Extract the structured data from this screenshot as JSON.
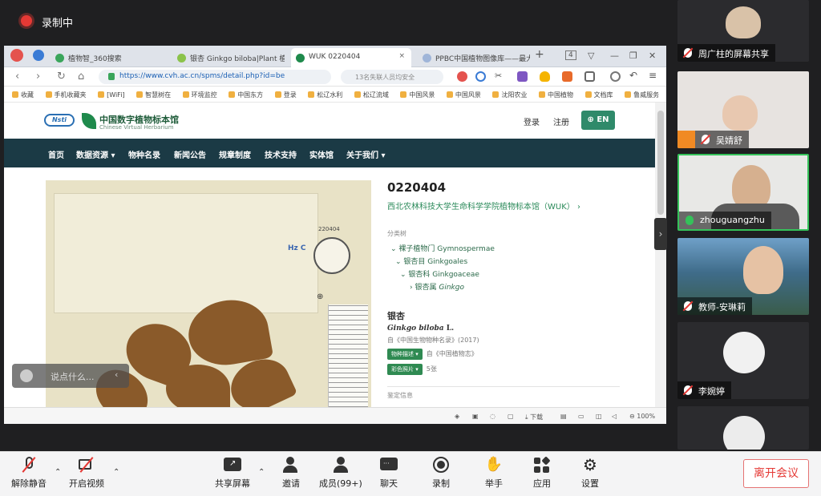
{
  "recording": {
    "label": "录制中"
  },
  "browser": {
    "tabs": [
      {
        "label": "植物智_360搜索"
      },
      {
        "label": "银杏 Ginkgo biloba|Plant 植物"
      },
      {
        "label": "WUK 0220404"
      },
      {
        "label": "PPBC中国植物图像库——最大"
      }
    ],
    "tab_count": "4",
    "url": "https://www.cvh.ac.cn/spms/detail.php?id=be",
    "search_placeholder": "13名失联人员均安全",
    "bookmarks": [
      "收藏",
      "手机收藏夹",
      "[WiFi]",
      "智慧树在",
      "环境监控",
      "中国东方",
      "登录",
      "松辽水利",
      "松辽流域",
      "中国风景",
      "中国风景",
      "沈阳农业",
      "中国植物",
      "文档库",
      "鲁威服务"
    ],
    "zoom": "100%",
    "status": {
      "download": "下载"
    }
  },
  "site": {
    "logo_text": "Nsti",
    "name_cn": "中国数字植物标本馆",
    "name_en": "Chinese Virtual Herbarium",
    "login": "登录",
    "register": "注册",
    "lang_button": "EN",
    "nav": [
      "首页",
      "数据资源",
      "物种名录",
      "新闻公告",
      "规章制度",
      "技术支持",
      "实体馆",
      "关于我们"
    ]
  },
  "specimen": {
    "label_number": "220404",
    "stamp_text": "Hz C",
    "code": "0220404",
    "institution": "西北农林科技大学生命科学学院植物标本馆（WUK）",
    "section_taxonomy": "分类树",
    "taxonomy": [
      {
        "cn": "裸子植物门",
        "latin": "Gymnospermae"
      },
      {
        "cn": "银杏目",
        "latin": "Ginkgoales"
      },
      {
        "cn": "银杏科",
        "latin": "Ginkgoaceae"
      },
      {
        "cn": "银杏属",
        "latin": "Ginkgo"
      }
    ],
    "name_cn": "银杏",
    "name_latin": "Ginkgo biloba",
    "name_author": "L.",
    "source": "自《中国生物物种名录》(2017)",
    "btn_description": "物种描述",
    "description_source": "自《中国植物志》",
    "btn_photos": "彩色照片",
    "photo_count": "5张",
    "section_collection": "鉴定信息"
  },
  "chat": {
    "placeholder": "说点什么..."
  },
  "participants": [
    {
      "name": "周广柱的屏幕共享"
    },
    {
      "name": "吴婧舒"
    },
    {
      "name": "zhouguangzhu"
    },
    {
      "name": "教师-安琳莉"
    },
    {
      "name": "李婉婷"
    }
  ],
  "toolbar": {
    "unmute": "解除静音",
    "start_video": "开启视频",
    "share_screen": "共享屏幕",
    "invite": "邀请",
    "members": "成员(99+)",
    "chat": "聊天",
    "record": "录制",
    "raise_hand": "举手",
    "apps": "应用",
    "settings": "设置",
    "leave": "离开会议"
  }
}
